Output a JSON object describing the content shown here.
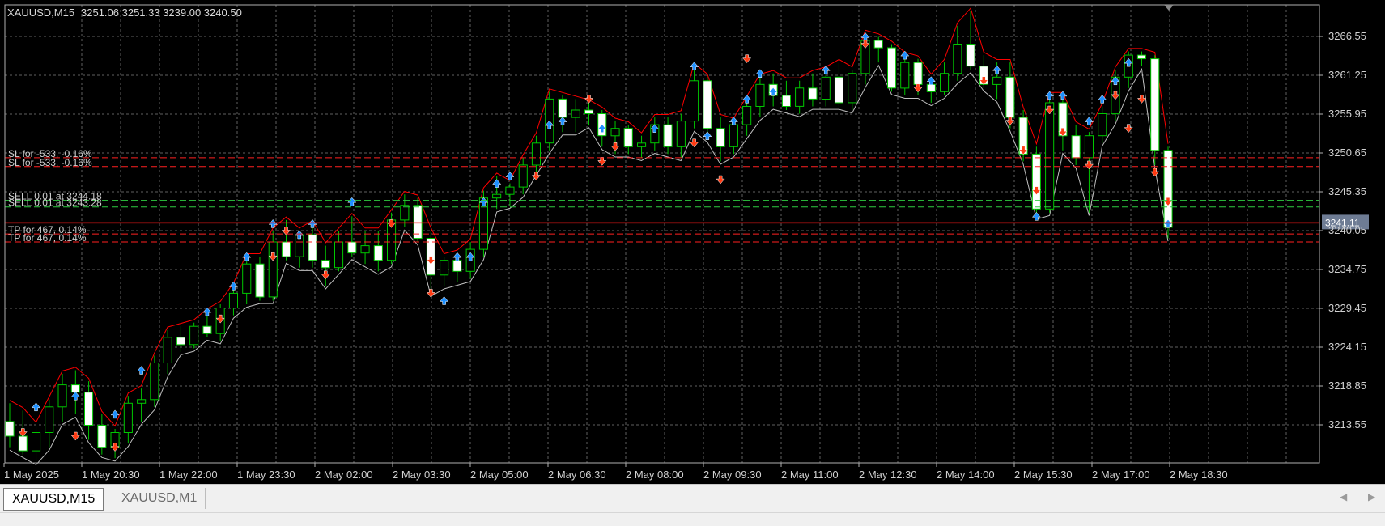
{
  "header": {
    "symbol": "XAUUSD,M15",
    "ohlc": "3251.06 3251.33 3239.00 3240.50"
  },
  "tabs": [
    {
      "label": "XAUUSD,M15",
      "active": true
    },
    {
      "label": "XAUUSD,M1",
      "active": false
    }
  ],
  "colors": {
    "background": "#000000",
    "grid": "#5f5f5f",
    "bull_body": "#000000",
    "bear_body": "#ffffff",
    "candle_outline": "#00c800",
    "upper_band": "#ff0000",
    "lower_band": "#c0c0c0",
    "buy_arrow": "#1e90ff",
    "sell_arrow": "#ff3c14",
    "sl_tp_line": "#ff2020",
    "order_line": "#2ecc40",
    "price_line": "#ff1a1a",
    "price_tag_bg": "#6e7c94"
  },
  "chart_data": {
    "type": "candlestick",
    "symbol": "XAUUSD",
    "timeframe": "M15",
    "ylim": [
      3208.5,
      3270.5
    ],
    "y_ticks": [
      "3266.55",
      "3261.25",
      "3255.95",
      "3250.65",
      "3245.35",
      "3240.05",
      "3234.75",
      "3229.45",
      "3224.15",
      "3218.85",
      "3213.55"
    ],
    "x_labels": [
      "1 May 2025",
      "1 May 20:30",
      "1 May 22:00",
      "1 May 23:30",
      "2 May 02:00",
      "2 May 03:30",
      "2 May 05:00",
      "2 May 06:30",
      "2 May 08:00",
      "2 May 09:30",
      "2 May 11:00",
      "2 May 12:30",
      "2 May 14:00",
      "2 May 15:30",
      "2 May 17:00",
      "2 May 18:30"
    ],
    "candles": [
      [
        3214.0,
        3216.5,
        3210.5,
        3212.0
      ],
      [
        3212.0,
        3215.5,
        3209.5,
        3210.0
      ],
      [
        3210.0,
        3213.5,
        3208.5,
        3212.5
      ],
      [
        3212.5,
        3217.0,
        3210.5,
        3216.0
      ],
      [
        3216.0,
        3220.5,
        3214.0,
        3219.0
      ],
      [
        3219.0,
        3221.0,
        3215.0,
        3218.0
      ],
      [
        3218.0,
        3219.5,
        3211.5,
        3213.5
      ],
      [
        3213.5,
        3215.0,
        3209.5,
        3210.5
      ],
      [
        3210.5,
        3213.0,
        3209.0,
        3212.5
      ],
      [
        3212.5,
        3217.5,
        3211.0,
        3216.5
      ],
      [
        3216.5,
        3218.5,
        3214.0,
        3217.0
      ],
      [
        3217.0,
        3223.0,
        3216.0,
        3222.0
      ],
      [
        3222.0,
        3226.5,
        3220.5,
        3225.5
      ],
      [
        3225.5,
        3227.0,
        3223.5,
        3224.5
      ],
      [
        3224.5,
        3227.5,
        3224.0,
        3227.0
      ],
      [
        3227.0,
        3229.0,
        3225.5,
        3226.0
      ],
      [
        3226.0,
        3230.0,
        3225.0,
        3229.5
      ],
      [
        3229.5,
        3232.5,
        3228.5,
        3231.5
      ],
      [
        3231.5,
        3236.5,
        3230.0,
        3235.5
      ],
      [
        3235.5,
        3236.5,
        3230.5,
        3231.0
      ],
      [
        3231.0,
        3240.0,
        3230.5,
        3238.5
      ],
      [
        3238.5,
        3241.5,
        3236.0,
        3236.5
      ],
      [
        3236.5,
        3240.0,
        3235.0,
        3239.5
      ],
      [
        3239.5,
        3241.0,
        3235.0,
        3236.0
      ],
      [
        3236.0,
        3238.0,
        3232.5,
        3235.0
      ],
      [
        3235.0,
        3240.0,
        3234.5,
        3238.5
      ],
      [
        3238.5,
        3242.0,
        3236.5,
        3237.0
      ],
      [
        3237.0,
        3240.0,
        3235.5,
        3238.0
      ],
      [
        3238.0,
        3240.0,
        3234.5,
        3236.0
      ],
      [
        3236.0,
        3242.5,
        3235.5,
        3241.5
      ],
      [
        3241.5,
        3245.0,
        3240.5,
        3243.5
      ],
      [
        3243.5,
        3244.5,
        3238.5,
        3239.0
      ],
      [
        3239.0,
        3240.0,
        3231.5,
        3234.0
      ],
      [
        3234.0,
        3236.5,
        3232.5,
        3236.0
      ],
      [
        3236.0,
        3237.0,
        3233.0,
        3234.5
      ],
      [
        3234.5,
        3238.5,
        3233.5,
        3237.5
      ],
      [
        3237.5,
        3245.5,
        3236.5,
        3244.5
      ],
      [
        3244.5,
        3247.5,
        3243.0,
        3245.0
      ],
      [
        3245.0,
        3246.5,
        3243.5,
        3246.0
      ],
      [
        3246.0,
        3250.0,
        3245.0,
        3249.0
      ],
      [
        3249.0,
        3253.0,
        3248.0,
        3252.0
      ],
      [
        3252.0,
        3259.0,
        3251.0,
        3258.0
      ],
      [
        3258.0,
        3258.5,
        3253.5,
        3255.5
      ],
      [
        3255.5,
        3258.0,
        3253.5,
        3256.5
      ],
      [
        3256.5,
        3257.5,
        3254.5,
        3256.0
      ],
      [
        3256.0,
        3256.5,
        3251.5,
        3253.0
      ],
      [
        3253.0,
        3255.0,
        3250.5,
        3254.0
      ],
      [
        3254.0,
        3254.5,
        3250.5,
        3251.5
      ],
      [
        3251.5,
        3253.0,
        3250.0,
        3252.0
      ],
      [
        3252.0,
        3255.5,
        3251.0,
        3254.5
      ],
      [
        3254.5,
        3255.5,
        3250.5,
        3251.5
      ],
      [
        3251.5,
        3256.0,
        3250.0,
        3255.0
      ],
      [
        3255.0,
        3262.5,
        3254.0,
        3260.5
      ],
      [
        3260.5,
        3261.0,
        3252.5,
        3254.0
      ],
      [
        3254.0,
        3255.5,
        3249.5,
        3251.5
      ],
      [
        3251.5,
        3255.0,
        3250.5,
        3254.5
      ],
      [
        3254.5,
        3258.0,
        3253.0,
        3257.0
      ],
      [
        3257.0,
        3261.0,
        3255.5,
        3260.0
      ],
      [
        3260.0,
        3261.5,
        3257.0,
        3258.5
      ],
      [
        3258.5,
        3260.5,
        3256.5,
        3257.0
      ],
      [
        3257.0,
        3260.5,
        3256.0,
        3259.5
      ],
      [
        3259.5,
        3261.5,
        3257.0,
        3258.0
      ],
      [
        3258.0,
        3262.0,
        3257.0,
        3261.0
      ],
      [
        3261.0,
        3263.0,
        3257.0,
        3257.5
      ],
      [
        3257.5,
        3262.0,
        3256.5,
        3261.5
      ],
      [
        3261.5,
        3267.0,
        3260.0,
        3266.0
      ],
      [
        3266.0,
        3266.5,
        3263.0,
        3265.0
      ],
      [
        3265.0,
        3265.5,
        3259.0,
        3259.5
      ],
      [
        3259.5,
        3264.0,
        3258.5,
        3263.0
      ],
      [
        3263.0,
        3263.5,
        3258.5,
        3260.0
      ],
      [
        3260.0,
        3261.0,
        3257.5,
        3259.0
      ],
      [
        3259.0,
        3263.0,
        3258.5,
        3261.5
      ],
      [
        3261.5,
        3268.0,
        3260.5,
        3265.5
      ],
      [
        3265.5,
        3270.0,
        3262.0,
        3262.5
      ],
      [
        3262.5,
        3264.0,
        3259.5,
        3260.0
      ],
      [
        3260.0,
        3263.0,
        3258.0,
        3261.0
      ],
      [
        3261.0,
        3263.0,
        3254.0,
        3255.5
      ],
      [
        3255.5,
        3256.5,
        3249.5,
        3250.5
      ],
      [
        3250.5,
        3251.5,
        3242.0,
        3243.0
      ],
      [
        3243.0,
        3258.5,
        3242.5,
        3257.5
      ],
      [
        3257.5,
        3258.5,
        3251.0,
        3253.0
      ],
      [
        3253.0,
        3254.5,
        3249.0,
        3250.0
      ],
      [
        3250.0,
        3253.5,
        3242.5,
        3253.0
      ],
      [
        3253.0,
        3257.0,
        3252.0,
        3256.0
      ],
      [
        3256.0,
        3262.0,
        3255.0,
        3261.0
      ],
      [
        3261.0,
        3264.5,
        3259.5,
        3264.0
      ],
      [
        3264.0,
        3264.5,
        3262.5,
        3263.5
      ],
      [
        3263.5,
        3264.0,
        3249.0,
        3251.0
      ],
      [
        3251.0,
        3251.5,
        3239.0,
        3240.5
      ]
    ],
    "buy_arrows": [
      [
        2,
        3216.0
      ],
      [
        5,
        3217.5
      ],
      [
        8,
        3215.0
      ],
      [
        10,
        3221.0
      ],
      [
        15,
        3229.0
      ],
      [
        17,
        3232.5
      ],
      [
        18,
        3236.5
      ],
      [
        20,
        3241.0
      ],
      [
        22,
        3239.5
      ],
      [
        23,
        3241.0
      ],
      [
        26,
        3244.0
      ],
      [
        33,
        3230.5
      ],
      [
        34,
        3236.5
      ],
      [
        35,
        3236.5
      ],
      [
        36,
        3244.0
      ],
      [
        37,
        3246.5
      ],
      [
        38,
        3247.5
      ],
      [
        41,
        3254.5
      ],
      [
        42,
        3255.0
      ],
      [
        45,
        3254.0
      ],
      [
        49,
        3254.0
      ],
      [
        52,
        3262.5
      ],
      [
        53,
        3253.0
      ],
      [
        55,
        3255.0
      ],
      [
        56,
        3258.0
      ],
      [
        57,
        3261.5
      ],
      [
        58,
        3259.0
      ],
      [
        62,
        3262.0
      ],
      [
        65,
        3266.5
      ],
      [
        68,
        3264.0
      ],
      [
        70,
        3260.5
      ],
      [
        75,
        3262.0
      ],
      [
        78,
        3242.0
      ],
      [
        79,
        3258.5
      ],
      [
        80,
        3258.5
      ],
      [
        82,
        3255.0
      ],
      [
        83,
        3258.0
      ],
      [
        84,
        3260.5
      ],
      [
        85,
        3263.0
      ],
      [
        88,
        3241.0
      ]
    ],
    "sell_arrows": [
      [
        1,
        3212.5
      ],
      [
        5,
        3212.0
      ],
      [
        8,
        3210.5
      ],
      [
        16,
        3228.0
      ],
      [
        20,
        3236.5
      ],
      [
        21,
        3240.0
      ],
      [
        24,
        3234.0
      ],
      [
        29,
        3241.0
      ],
      [
        32,
        3236.0
      ],
      [
        32,
        3231.5
      ],
      [
        40,
        3247.5
      ],
      [
        44,
        3258.0
      ],
      [
        45,
        3249.5
      ],
      [
        46,
        3251.5
      ],
      [
        52,
        3252.0
      ],
      [
        54,
        3247.0
      ],
      [
        56,
        3263.5
      ],
      [
        65,
        3265.5
      ],
      [
        69,
        3259.5
      ],
      [
        74,
        3260.5
      ],
      [
        76,
        3255.0
      ],
      [
        77,
        3251.0
      ],
      [
        78,
        3245.5
      ],
      [
        79,
        3256.5
      ],
      [
        80,
        3253.5
      ],
      [
        82,
        3249.0
      ],
      [
        84,
        3258.5
      ],
      [
        85,
        3254.0
      ],
      [
        86,
        3258.0
      ],
      [
        87,
        3248.0
      ],
      [
        88,
        3244.0
      ]
    ],
    "trade_levels": [
      {
        "label": "SL for -533, -0.16%",
        "price": 3250.0,
        "style": "sl"
      },
      {
        "label": "SL for -533, -0.16%",
        "price": 3248.8,
        "style": "sl"
      },
      {
        "label": "SELL 0.01 at 3244.18",
        "price": 3244.18,
        "style": "order"
      },
      {
        "label": "SELL 0.01 at 3243.28",
        "price": 3243.28,
        "style": "order"
      },
      {
        "label": "TP for 467, 0.14%",
        "price": 3239.6,
        "style": "tp"
      },
      {
        "label": "TP for 467, 0.14%",
        "price": 3238.5,
        "style": "tp"
      }
    ],
    "current_price": "3241.11",
    "current_price_value": 3241.11
  }
}
